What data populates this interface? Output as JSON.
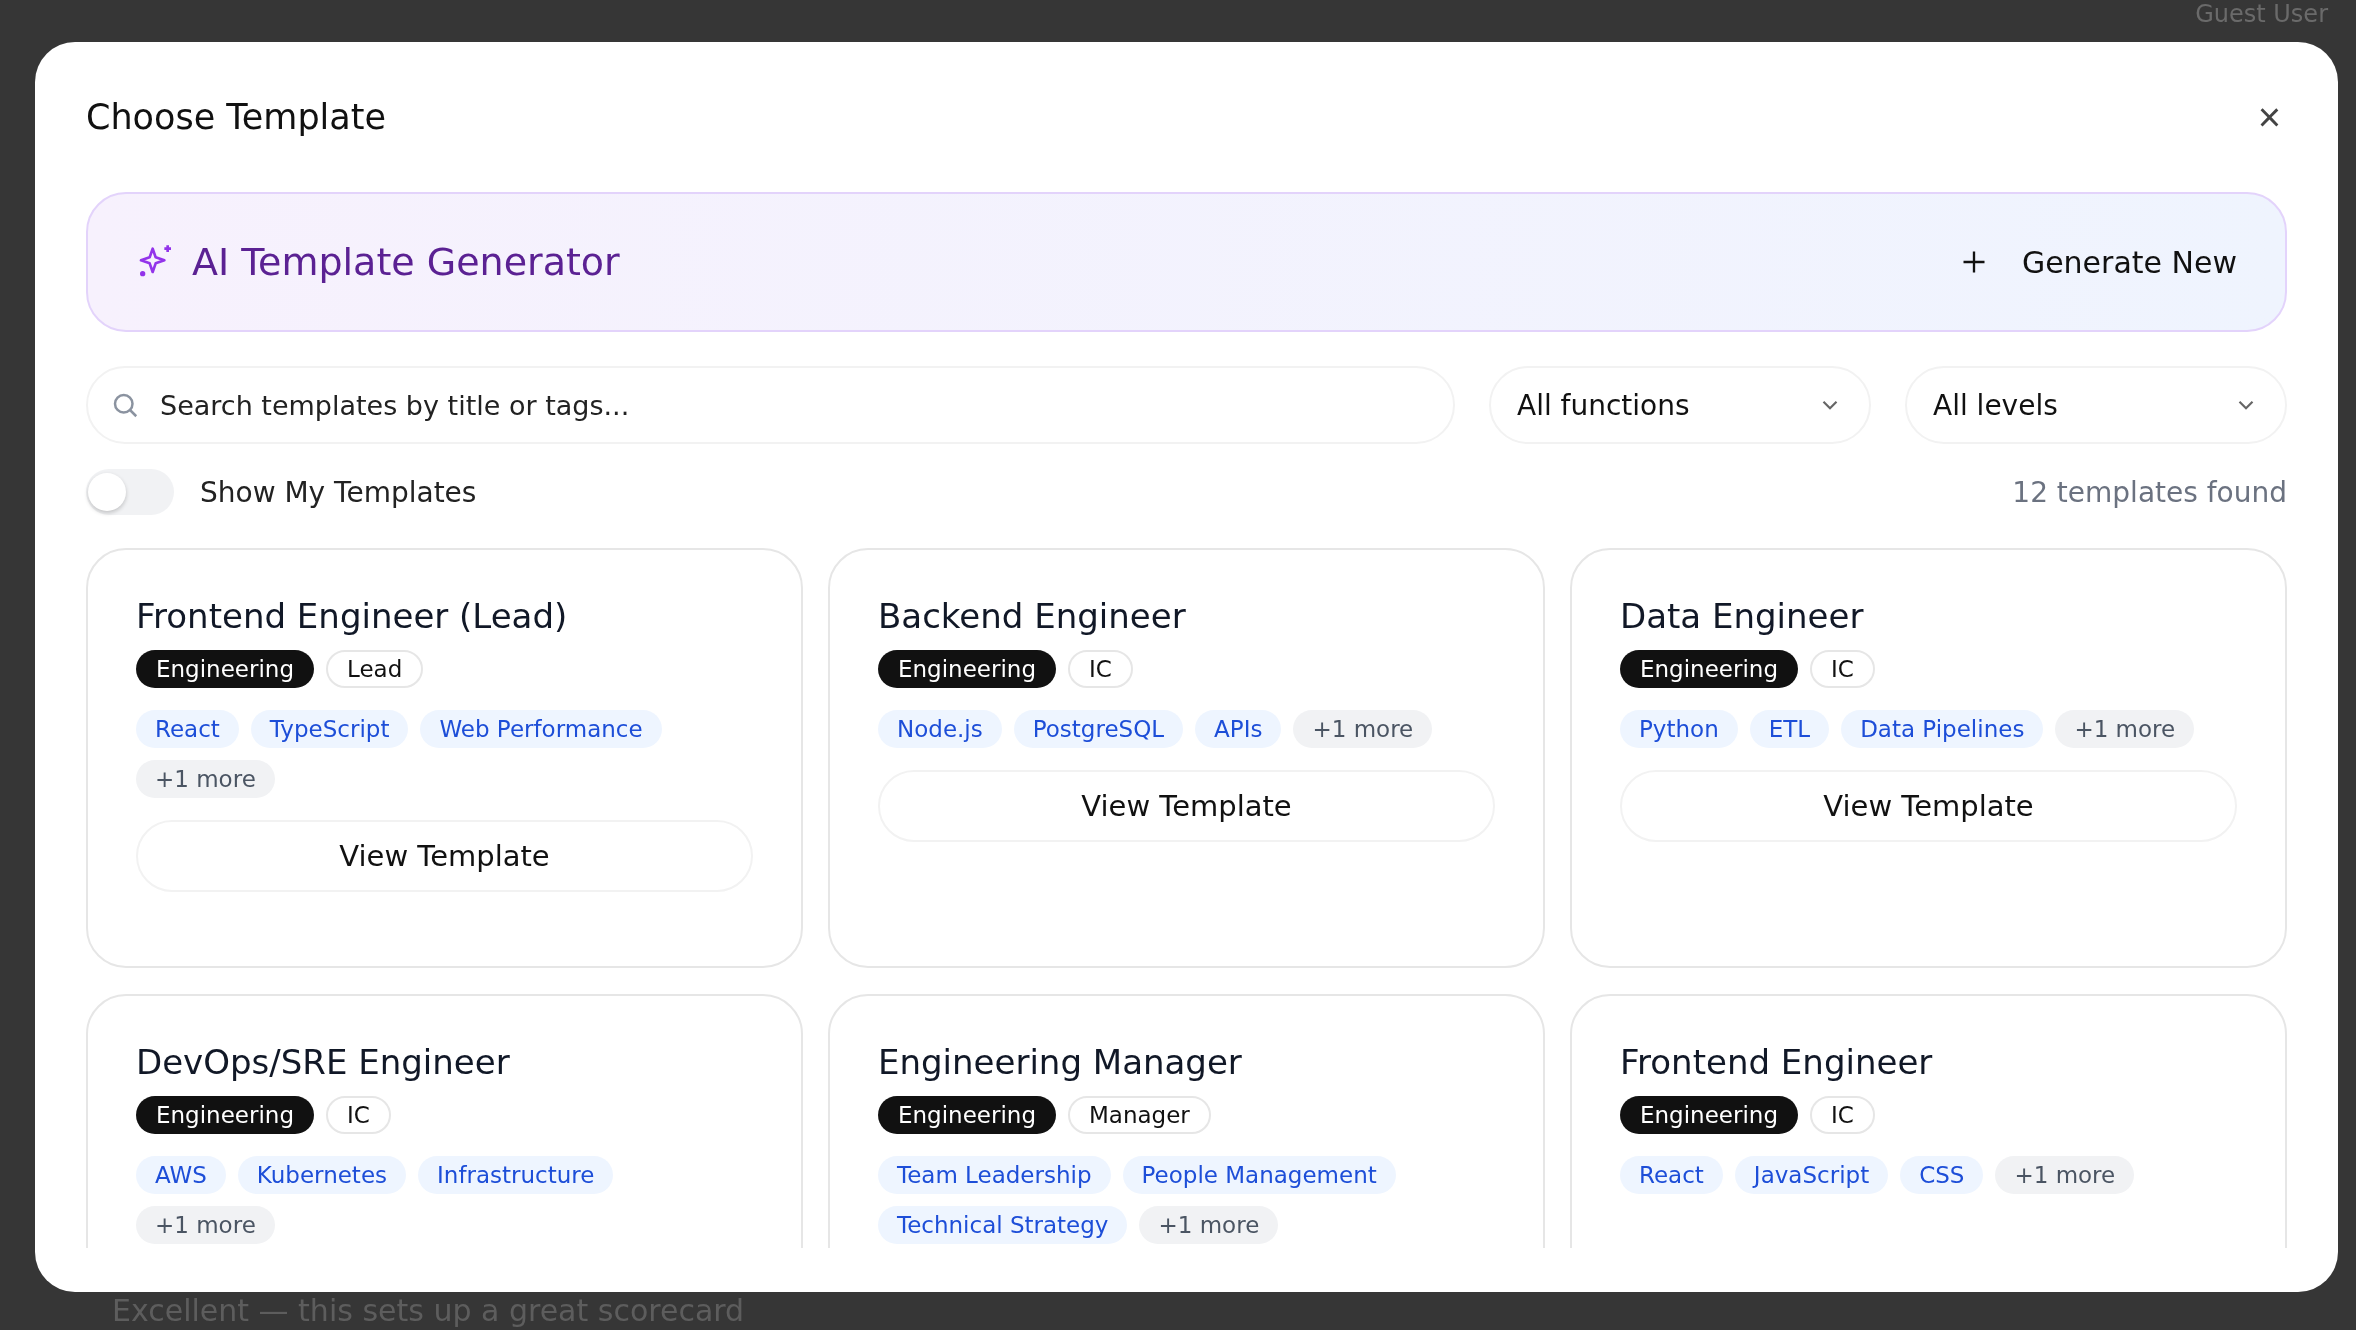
{
  "background": {
    "user_name": "Guest User",
    "message": "Excellent — this sets up a great scorecard"
  },
  "dialog": {
    "title": "Choose Template",
    "close": "×"
  },
  "ai_banner": {
    "title": "AI Template Generator",
    "action": "Generate New"
  },
  "search": {
    "placeholder": "Search templates by title or tags..."
  },
  "filters": [
    {
      "value": "All functions"
    },
    {
      "value": "All levels"
    }
  ],
  "my_templates_toggle": {
    "label": "Show My Templates",
    "on": false
  },
  "result_count": "12 templates found",
  "templates": [
    {
      "title": "Frontend Engineer (Lead)",
      "function": "Engineering",
      "level": "Lead",
      "skills": [
        "React",
        "TypeScript",
        "Web Performance"
      ],
      "more": "+1 more",
      "button": "View Template"
    },
    {
      "title": "Backend Engineer",
      "function": "Engineering",
      "level": "IC",
      "skills": [
        "Node.js",
        "PostgreSQL",
        "APIs"
      ],
      "more": "+1 more",
      "button": "View Template"
    },
    {
      "title": "Data Engineer",
      "function": "Engineering",
      "level": "IC",
      "skills": [
        "Python",
        "ETL",
        "Data Pipelines"
      ],
      "more": "+1 more",
      "button": "View Template"
    },
    {
      "title": "DevOps/SRE Engineer",
      "function": "Engineering",
      "level": "IC",
      "skills": [
        "AWS",
        "Kubernetes",
        "Infrastructure"
      ],
      "more": "+1 more"
    },
    {
      "title": "Engineering Manager",
      "function": "Engineering",
      "level": "Manager",
      "skills": [
        "Team Leadership",
        "People Management",
        "Technical Strategy"
      ],
      "more": "+1 more"
    },
    {
      "title": "Frontend Engineer",
      "function": "Engineering",
      "level": "IC",
      "skills": [
        "React",
        "JavaScript",
        "CSS"
      ],
      "more": "+1 more"
    }
  ]
}
